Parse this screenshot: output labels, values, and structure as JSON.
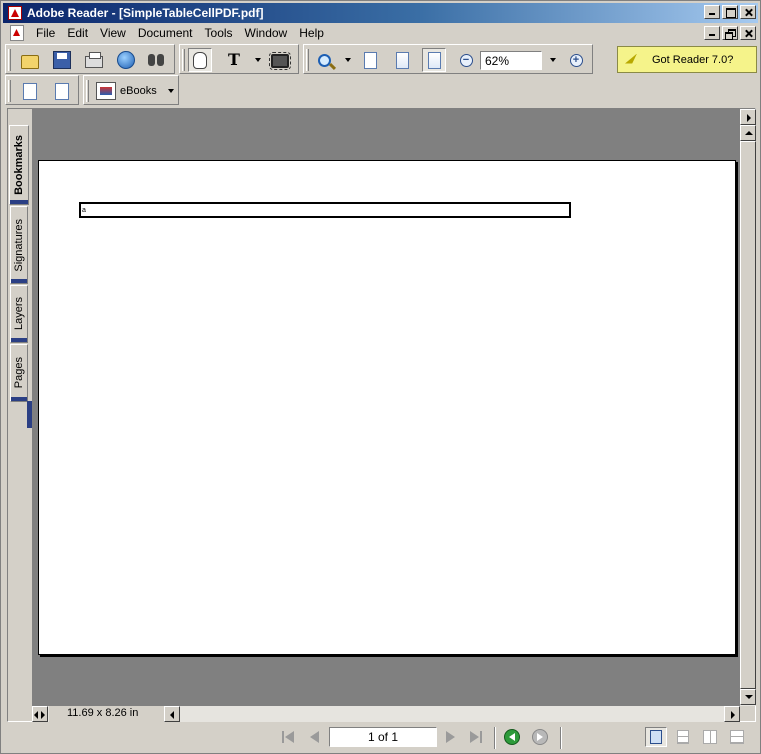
{
  "window": {
    "title": "Adobe Reader - [SimpleTableCellPDF.pdf]"
  },
  "menu": {
    "items": [
      "File",
      "Edit",
      "View",
      "Document",
      "Tools",
      "Window",
      "Help"
    ]
  },
  "toolbar": {
    "zoom_value": "62%",
    "promo_label": "Got Reader 7.0?",
    "ebooks_label": "eBooks"
  },
  "side_tabs": [
    "Bookmarks",
    "Signatures",
    "Layers",
    "Pages"
  ],
  "document": {
    "cell_text": "a",
    "page_size": "11.69 x 8.26 in"
  },
  "status": {
    "page_indicator": "1 of 1"
  },
  "colors": {
    "title_bar": "#0a246a",
    "canvas_bg": "#808080",
    "chrome": "#d4d0c8",
    "promo_bg": "#f5f38a",
    "tab_accent": "#2b3f84"
  },
  "icons": [
    "open-icon",
    "save-icon",
    "print-icon",
    "email-icon",
    "search-icon",
    "hand-icon",
    "select-text-icon",
    "snapshot-icon",
    "zoom-in-icon",
    "actual-size-icon",
    "fit-page-icon",
    "fit-width-icon",
    "zoom-out-icon",
    "zoom-plus-icon",
    "rotate-cw-icon",
    "rotate-ccw-icon",
    "ebooks-icon"
  ]
}
